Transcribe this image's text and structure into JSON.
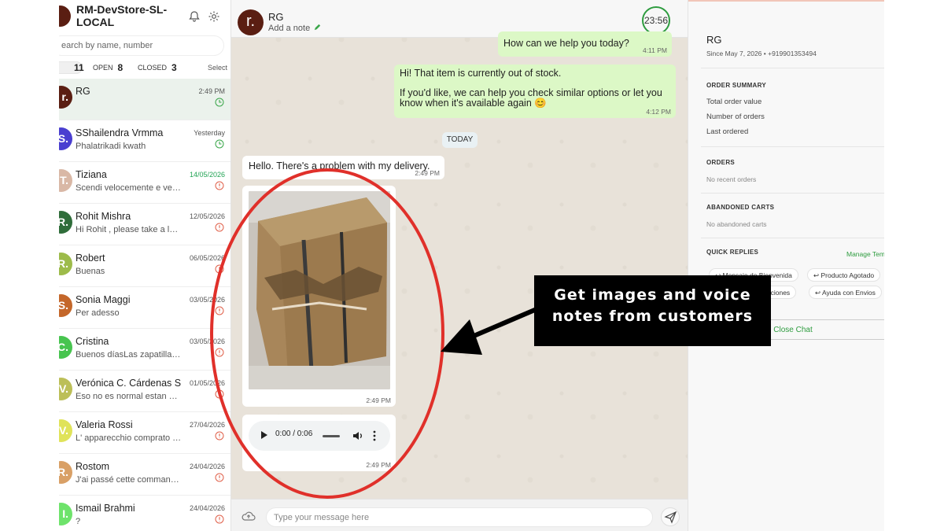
{
  "sidebar": {
    "store_name": "RM-DevStore-SL-LOCAL",
    "search_placeholder": "earch by name, number",
    "filters": [
      {
        "label": "",
        "count": "11"
      },
      {
        "label": "OPEN",
        "count": "8"
      },
      {
        "label": "CLOSED",
        "count": "3"
      }
    ],
    "select_label": "Select",
    "conversations": [
      {
        "initial": "r.",
        "name": "RG",
        "preview": "",
        "date": "2:49 PM",
        "avatar_color": "#5a1e12",
        "date_color": "normal",
        "status_icon": "clock-icon"
      },
      {
        "initial": "S.",
        "name": "SShailendra Vrmma",
        "preview": "Phalatrikadi kwath",
        "date": "Yesterday",
        "avatar_color": "#4a3fd0",
        "date_color": "normal",
        "status_icon": "clock-icon"
      },
      {
        "initial": "T.",
        "name": "Tiziana",
        "preview": "Scendi velocemente e vedr…",
        "date": "14/05/2026",
        "avatar_color": "#d9b8a6",
        "date_color": "green",
        "status_icon": "info-icon"
      },
      {
        "initial": "R.",
        "name": "Rohit Mishra",
        "preview": "Hi Rohit , please take a look…",
        "date": "12/05/2026",
        "avatar_color": "#2f6d3a",
        "date_color": "normal",
        "status_icon": "info-icon"
      },
      {
        "initial": "R.",
        "name": "Robert",
        "preview": "Buenas",
        "date": "06/05/2026",
        "avatar_color": "#9dbb4a",
        "date_color": "normal",
        "status_icon": "info-icon"
      },
      {
        "initial": "S.",
        "name": "Sonia Maggi",
        "preview": "Per adesso",
        "date": "03/05/2026",
        "avatar_color": "#c4672a",
        "date_color": "normal",
        "status_icon": "info-icon"
      },
      {
        "initial": "C.",
        "name": "Cristina",
        "preview": "Buenos díasLas zapatillas …",
        "date": "03/05/2026",
        "avatar_color": "#47c44f",
        "date_color": "normal",
        "status_icon": "info-icon"
      },
      {
        "initial": "V.",
        "name": "Verónica C. Cárdenas S.",
        "preview": "Eso no es normal estan 10…",
        "date": "01/05/2026",
        "avatar_color": "#bcbf58",
        "date_color": "normal",
        "status_icon": "info-icon"
      },
      {
        "initial": "V.",
        "name": "Valeria Rossi",
        "preview": "L' apparecchio comprato n…",
        "date": "27/04/2026",
        "avatar_color": "#e0e35a",
        "date_color": "normal",
        "status_icon": "info-icon"
      },
      {
        "initial": "R.",
        "name": "Rostom",
        "preview": "J'ai passé cette command…",
        "date": "24/04/2026",
        "avatar_color": "#d9a066",
        "date_color": "normal",
        "status_icon": "info-icon"
      },
      {
        "initial": "I.",
        "name": "Ismail Brahmi",
        "preview": "?",
        "date": "24/04/2026",
        "avatar_color": "#6ee36b",
        "date_color": "normal",
        "status_icon": "info-icon"
      }
    ]
  },
  "chat": {
    "contact_initial": "r.",
    "contact_name": "RG",
    "add_note": "Add a note",
    "timer": "23:56",
    "messages": [
      {
        "text": "How can we help you today?",
        "time": "4:11 PM"
      },
      {
        "line1": "Hi! That item is currently out of stock.",
        "line2": "If you'd like, we can help you check similar options or let you know when it's available again 😊",
        "time": "4:12 PM"
      },
      {
        "text": "Hello. There's a problem with my delivery.",
        "time": "2:49 PM"
      },
      {
        "time": "2:49 PM"
      },
      {
        "audio_time": "0:00 / 0:06",
        "time": "2:49 PM"
      }
    ],
    "day_separator": "TODAY",
    "composer_placeholder": "Type your message here"
  },
  "panel": {
    "name": "RG",
    "since": "Since May 7, 2026 • +919901353494",
    "order_summary_title": "ORDER SUMMARY",
    "total_order_value": "Total order value",
    "number_of_orders": "Number of orders",
    "last_ordered": "Last ordered",
    "orders_title": "ORDERS",
    "no_orders": "No recent orders",
    "carts_title": "ABANDONED CARTS",
    "no_carts": "No abandoned carts",
    "quick_replies_title": "QUICK REPLIES",
    "manage_templates": "Manage Tem",
    "quick_replies": [
      "Mensaje de Bienvenida",
      "Producto Agotado",
      "luciones",
      "Ayuda con Envios"
    ],
    "close_chat": "Close Chat"
  },
  "annotation": {
    "line1": "Get images and voice",
    "line2": "notes from customers"
  },
  "colors": {
    "brand_green": "#2e9c3f",
    "outgoing_bubble": "#dcf8c6",
    "annotation_red": "#e0302a"
  }
}
